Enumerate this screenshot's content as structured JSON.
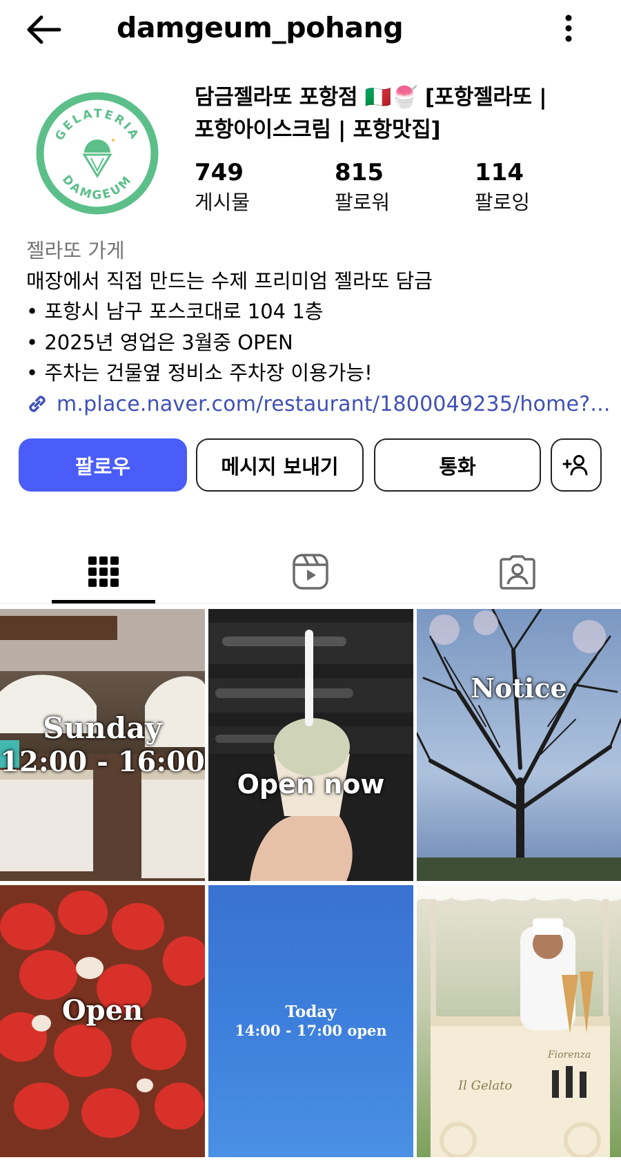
{
  "header": {
    "username": "damgeum_pohang"
  },
  "profile": {
    "display_name": "담금젤라또 포항점 🇮🇹🍧 [포항젤라또 | 포항아이스크림 | 포항맛집]",
    "display_name_line1": "담금젤라또 포항점 🇮🇹🍧 [포항젤라또 |",
    "display_name_line2": "포항아이스크림 | 포항맛집]",
    "avatar": {
      "top_text": "GELATERIA",
      "bottom_text": "DAMGEUM",
      "color": "#5cbf8a"
    }
  },
  "stats": [
    {
      "value": "749",
      "label": "게시물"
    },
    {
      "value": "815",
      "label": "팔로워"
    },
    {
      "value": "114",
      "label": "팔로잉"
    }
  ],
  "bio": {
    "category": "젤라또 가게",
    "lines": [
      "매장에서 직접 만드는 수제 프리미엄 젤라또 담금",
      "• 포항시 남구 포스코대로 104 1층",
      "• 2025년 영업은 3월중 OPEN",
      "• 주차는 건물옆 정비소 주차장 이용가능!"
    ],
    "link": "m.place.naver.com/restaurant/1800049235/home?..."
  },
  "actions": {
    "follow": "팔로우",
    "message": "메시지 보내기",
    "call": "통화",
    "suggest_icon": "add-person-icon"
  },
  "colors": {
    "accent": "#4a5df9",
    "link": "#3f51b5",
    "secondary_text": "#737373"
  },
  "tabs": [
    {
      "icon": "grid-icon",
      "active": true
    },
    {
      "icon": "reels-icon",
      "active": false
    },
    {
      "icon": "tagged-icon",
      "active": false
    }
  ],
  "posts": [
    {
      "text_line1": "Sunday",
      "text_line2": "12:00 - 16:00"
    },
    {
      "text_line1": "Open now"
    },
    {
      "text_line1": "Notice"
    },
    {
      "text_line1": "Open"
    },
    {
      "text_line1": "Today",
      "text_line2": "14:00 - 17:00 open"
    },
    {
      "text_line1": "Il Gelato",
      "text_line2": "Fiorenza"
    }
  ]
}
